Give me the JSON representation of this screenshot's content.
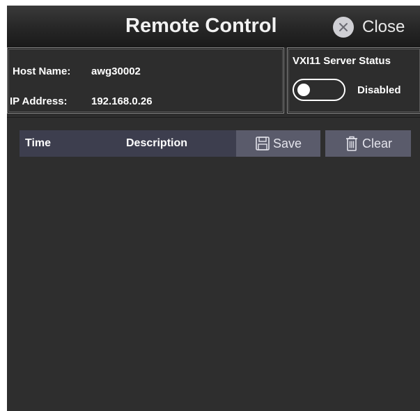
{
  "window": {
    "title": "Remote Control",
    "close_label": "Close"
  },
  "host_info": {
    "host_name_label": "Host Name:",
    "host_name_value": "awg30002",
    "ip_address_label": "IP Address:",
    "ip_address_value": "192.168.0.26"
  },
  "vxi11": {
    "title": "VXI11 Server Status",
    "toggle_on": false,
    "status": "Disabled"
  },
  "log": {
    "columns": [
      "Time",
      "Description"
    ],
    "save_label": "Save",
    "clear_label": "Clear",
    "rows": []
  },
  "icons": {
    "close": "close-circle-icon",
    "save": "floppy-disk-icon",
    "clear": "trash-can-icon"
  },
  "colors": {
    "background": "#2d2d2d",
    "header_bar": "#3d3e4e",
    "button": "#5a5b6b",
    "text": "#ffffff"
  }
}
